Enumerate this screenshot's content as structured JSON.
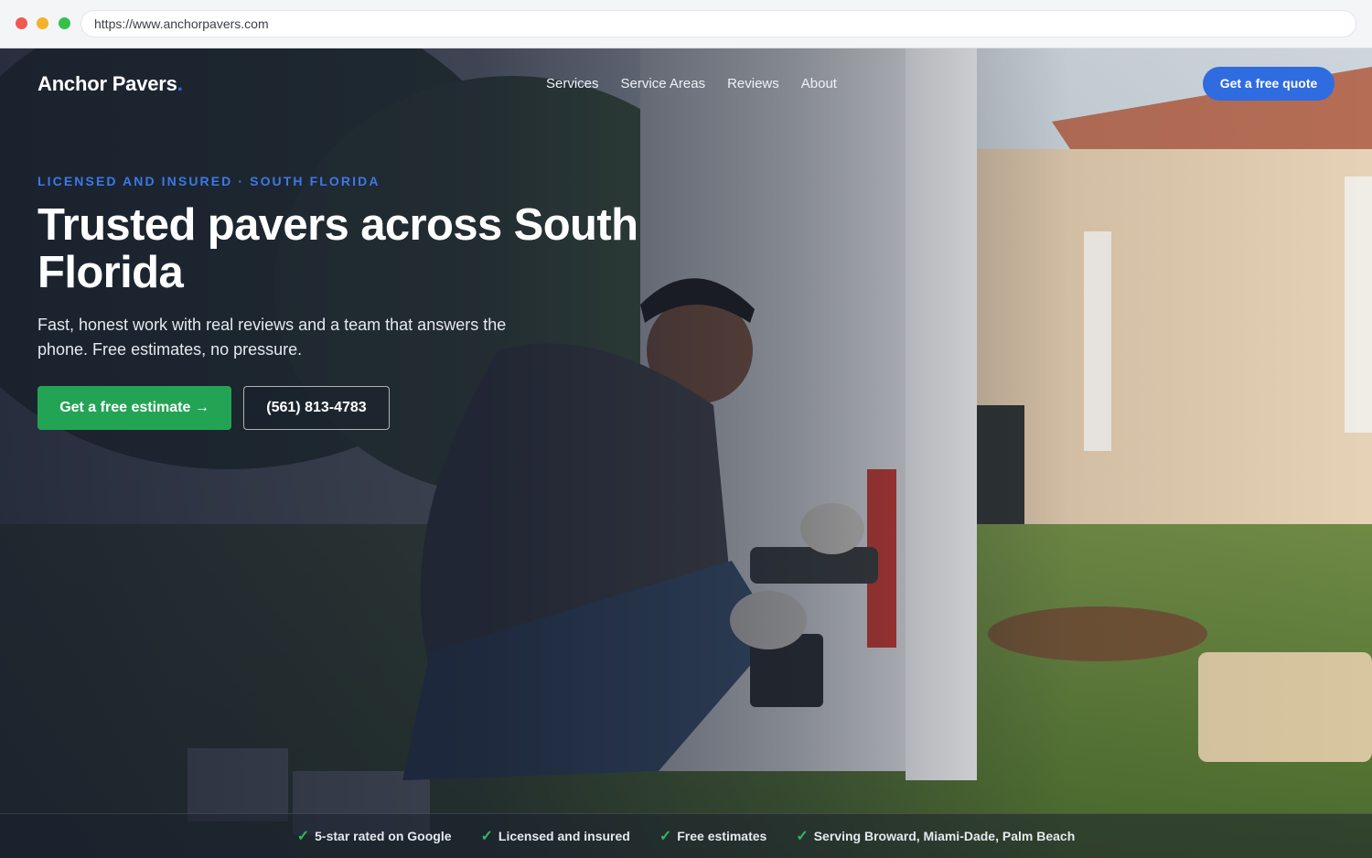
{
  "browser": {
    "url": "https://www.anchorpavers.com"
  },
  "header": {
    "logo_text": "Anchor Pavers",
    "logo_dot": ".",
    "nav": [
      "Services",
      "Service Areas",
      "Reviews",
      "About"
    ],
    "cta_label": "Get a free quote"
  },
  "hero": {
    "eyebrow": "LICENSED AND INSURED · SOUTH FLORIDA",
    "headline": "Trusted pavers across South Florida",
    "subtext": "Fast, honest work with real reviews and a team that answers the phone. Free estimates, no pressure.",
    "primary_cta": "Get a free estimate →",
    "phone_cta": "(561) 813-4783"
  },
  "trust_bar": [
    {
      "icon": "check-icon",
      "label": "5-star rated on Google"
    },
    {
      "icon": "check-icon",
      "label": "Licensed and insured"
    },
    {
      "icon": "check-icon",
      "label": "Free estimates"
    },
    {
      "icon": "check-icon",
      "label": "Serving Broward, Miami-Dade, Palm Beach"
    }
  ],
  "colors": {
    "accent_blue": "#2f6ce0",
    "cta_green": "#23a455",
    "check_green": "#2fb760",
    "overlay_navy": "#161c2d"
  }
}
